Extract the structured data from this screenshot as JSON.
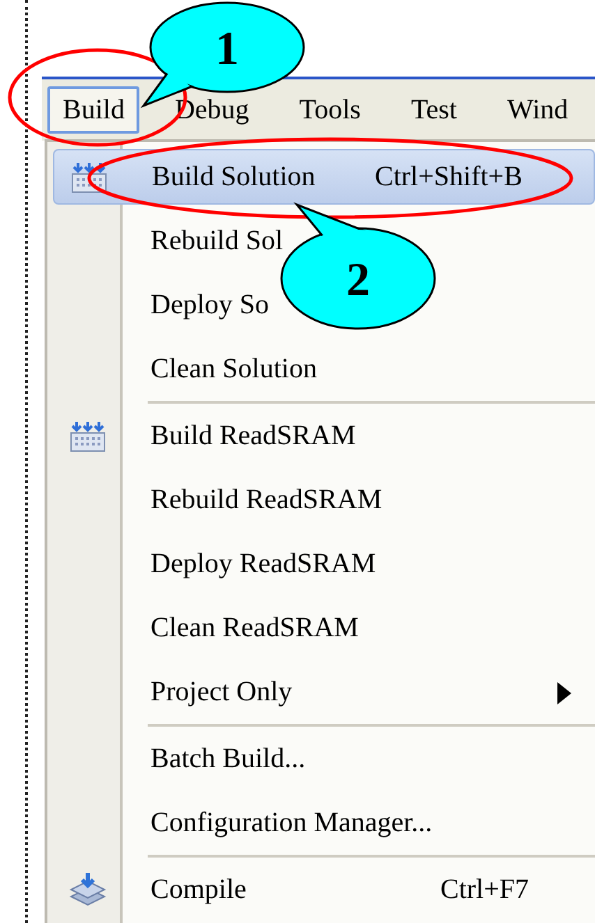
{
  "menu_bar": [
    {
      "label": "Build",
      "selected": true
    },
    {
      "label": "Debug",
      "selected": false
    },
    {
      "label": "Tools",
      "selected": false
    },
    {
      "label": "Test",
      "selected": false
    },
    {
      "label": "Wind",
      "selected": false
    }
  ],
  "menu": [
    {
      "kind": "item",
      "label": "Build Solution",
      "shortcut": "Ctrl+Shift+B",
      "selected": true
    },
    {
      "kind": "item",
      "label": "Rebuild Sol",
      "selected": false
    },
    {
      "kind": "item",
      "label": "Deploy So",
      "selected": false
    },
    {
      "kind": "item",
      "label": "Clean Solution",
      "selected": false
    },
    {
      "kind": "separator"
    },
    {
      "kind": "item",
      "label": "Build ReadSRAM",
      "selected": false
    },
    {
      "kind": "item",
      "label": "Rebuild ReadSRAM",
      "selected": false
    },
    {
      "kind": "item",
      "label": "Deploy ReadSRAM",
      "selected": false
    },
    {
      "kind": "item",
      "label": "Clean ReadSRAM",
      "selected": false
    },
    {
      "kind": "item",
      "label": "Project Only",
      "submenu": true,
      "selected": false
    },
    {
      "kind": "separator"
    },
    {
      "kind": "item",
      "label": "Batch Build...",
      "selected": false
    },
    {
      "kind": "item",
      "label": "Configuration Manager...",
      "selected": false
    },
    {
      "kind": "separator"
    },
    {
      "kind": "item",
      "label": "Compile",
      "shortcut": "Ctrl+F7",
      "selected": false
    }
  ],
  "callouts": [
    {
      "label": "1"
    },
    {
      "label": "2"
    }
  ]
}
